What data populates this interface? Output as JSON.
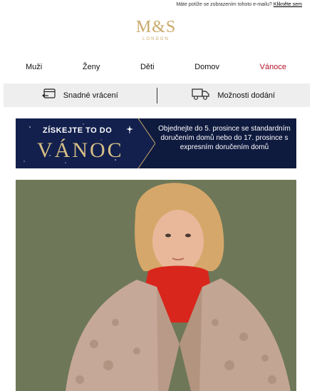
{
  "topbar": {
    "message": "Máte potíže se zobrazením tohoto e-mailu?",
    "link": "Klikněte sem"
  },
  "logo": {
    "mark": "M&S",
    "sub": "LONDON"
  },
  "nav": {
    "items": [
      "Muži",
      "Ženy",
      "Děti",
      "Domov",
      "Vánoce"
    ],
    "active_color": "#b3122a"
  },
  "benefits": [
    {
      "icon": "return-card-icon",
      "label": "Snadné vrácení"
    },
    {
      "icon": "delivery-truck-icon",
      "label": "Možnosti dodání"
    }
  ],
  "banner": {
    "top": "ZÍSKEJTE TO DO",
    "big": "VÁNOC",
    "text": "Objednejte do 5. prosince se standardním doručením domů nebo do 17. prosince s expresním doručením domů",
    "bg_color": "#0f1a3f",
    "gold_color": "#d7bf86"
  },
  "hero": {
    "bg_color": "#6f7a5a",
    "subject": "model-in-teddy-coat"
  }
}
